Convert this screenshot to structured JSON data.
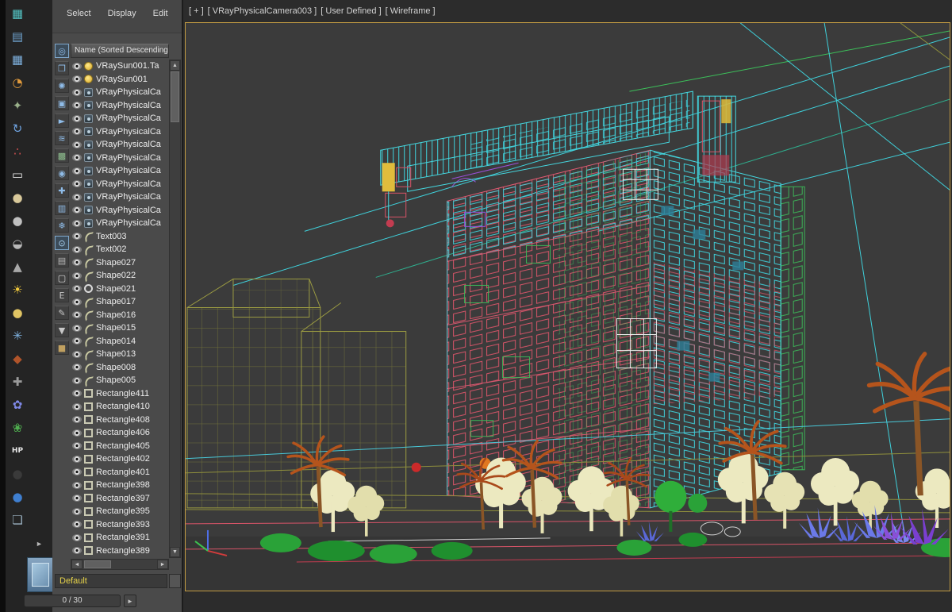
{
  "colors": {
    "viewport_border": "#c29b42",
    "viewport_bg": "#3b3b3b",
    "wire_cyan": "#45d8e0",
    "wire_red": "#e05a72",
    "wire_green": "#3cc05a",
    "wire_olive": "#8f8f3c",
    "name_field_text_color": "#e8d44a"
  },
  "glyphs": {
    "up": "▲",
    "down": "▼",
    "left": "◄",
    "right": "►"
  },
  "left_toolbar": {
    "buttons": [
      {
        "name": "schematic-view-icon",
        "glyph": "▦",
        "color": "#53c3c3"
      },
      {
        "name": "grid-page-icon",
        "glyph": "▤",
        "color": "#6fa3cf"
      },
      {
        "name": "table-grid-icon",
        "glyph": "▦",
        "color": "#7fb2e0"
      },
      {
        "name": "clock-icon",
        "glyph": "◔",
        "color": "#e09a3c"
      },
      {
        "name": "gear-icon",
        "glyph": "✦",
        "color": "#9ab08a"
      },
      {
        "name": "rotate-icon",
        "glyph": "↻",
        "color": "#6fa3e0"
      },
      {
        "name": "particles-icon",
        "glyph": "∴",
        "color": "#d05050"
      },
      {
        "name": "plane-icon",
        "glyph": "▭",
        "color": "#e8e8e8"
      },
      {
        "name": "blob-icon",
        "glyph": "●",
        "color": "#d8c89a"
      },
      {
        "name": "sphere-icon",
        "glyph": "●",
        "color": "#c0c0c0"
      },
      {
        "name": "pot-icon",
        "glyph": "◒",
        "color": "#b8b8b8"
      },
      {
        "name": "cone-icon",
        "glyph": "▲",
        "color": "#a8a8a8"
      },
      {
        "name": "sun-icon",
        "glyph": "☀",
        "color": "#f0c83c"
      },
      {
        "name": "geosphere-icon",
        "glyph": "●",
        "color": "#e0c464"
      },
      {
        "name": "scatter-icon",
        "glyph": "✳",
        "color": "#7fb2e0"
      },
      {
        "name": "pin-icon",
        "glyph": "◆",
        "color": "#b0542a"
      },
      {
        "name": "spray-icon",
        "glyph": "✚",
        "color": "#9a9a9a"
      },
      {
        "name": "flower-icon",
        "glyph": "✿",
        "color": "#7f89e8"
      },
      {
        "name": "leaf-icon",
        "glyph": "❀",
        "color": "#4fae4f"
      },
      {
        "name": "hp-icon",
        "glyph": "HP",
        "color": "#e8e8e8",
        "small": true
      },
      {
        "name": "dark-sphere-icon",
        "glyph": "●",
        "color": "#3a3a3a"
      },
      {
        "name": "blue-sphere-icon",
        "glyph": "●",
        "color": "#3f7fd0"
      },
      {
        "name": "layers-icon",
        "glyph": "❏",
        "color": "#9ab0c0"
      }
    ]
  },
  "scene_explorer": {
    "menu": [
      {
        "label": "Select"
      },
      {
        "label": "Display"
      },
      {
        "label": "Edit"
      }
    ],
    "sort_header": "Name (Sorted Descending)",
    "filter_buttons": [
      {
        "name": "select-all-filter-icon",
        "glyph": "◎",
        "color": "#8fbce8",
        "active": true
      },
      {
        "name": "children-filter-icon",
        "glyph": "❐",
        "color": "#8fbce8"
      },
      {
        "name": "lights-filter-icon",
        "glyph": "✺",
        "color": "#8fbce8"
      },
      {
        "name": "cameras-filter-icon",
        "glyph": "▣",
        "color": "#8fbce8"
      },
      {
        "name": "pointer-filter-icon",
        "glyph": "►",
        "color": "#8fbce8"
      },
      {
        "name": "space-warps-filter-icon",
        "glyph": "≋",
        "color": "#8fbce8"
      },
      {
        "name": "geometry-filter-icon",
        "glyph": "▩",
        "color": "#8fc08f"
      },
      {
        "name": "helpers-filter-icon",
        "glyph": "◉",
        "color": "#8fbce8"
      },
      {
        "name": "bones-filter-icon",
        "glyph": "✚",
        "color": "#8fbce8"
      },
      {
        "name": "containers-filter-icon",
        "glyph": "▥",
        "color": "#8fbce8"
      },
      {
        "name": "frozen-filter-icon",
        "glyph": "❄",
        "color": "#8fbce8"
      },
      {
        "name": "visibility-filter-icon",
        "glyph": "⊙",
        "color": "#aad4f4",
        "active": true
      },
      {
        "name": "document-icon",
        "glyph": "▤",
        "color": "#b8b8b8"
      },
      {
        "name": "box-filter-icon",
        "glyph": "▢",
        "color": "#d8d8d8"
      },
      {
        "name": "e-badge-icon",
        "glyph": "E",
        "color": "#c8c8c8"
      },
      {
        "name": "pen-icon",
        "glyph": "✎",
        "color": "#c8c8c8"
      },
      {
        "name": "funnel-filter-icon",
        "glyph": "▼",
        "color": "#c8c8c8"
      },
      {
        "name": "folder-icon",
        "glyph": "■",
        "color": "#c0a060"
      }
    ],
    "rows": [
      {
        "label": "VRaySun001.Ta",
        "type": "light"
      },
      {
        "label": "VRaySun001",
        "type": "light"
      },
      {
        "label": "VRayPhysicalCa",
        "type": "camera"
      },
      {
        "label": "VRayPhysicalCa",
        "type": "camera"
      },
      {
        "label": "VRayPhysicalCa",
        "type": "camera"
      },
      {
        "label": "VRayPhysicalCa",
        "type": "camera"
      },
      {
        "label": "VRayPhysicalCa",
        "type": "camera"
      },
      {
        "label": "VRayPhysicalCa",
        "type": "camera"
      },
      {
        "label": "VRayPhysicalCa",
        "type": "camera"
      },
      {
        "label": "VRayPhysicalCa",
        "type": "camera"
      },
      {
        "label": "VRayPhysicalCa",
        "type": "camera"
      },
      {
        "label": "VRayPhysicalCa",
        "type": "camera"
      },
      {
        "label": "VRayPhysicalCa",
        "type": "camera"
      },
      {
        "label": "Text003",
        "type": "spline"
      },
      {
        "label": "Text002",
        "type": "spline"
      },
      {
        "label": "Shape027",
        "type": "spline"
      },
      {
        "label": "Shape022",
        "type": "spline"
      },
      {
        "label": "Shape021",
        "type": "circle"
      },
      {
        "label": "Shape017",
        "type": "spline"
      },
      {
        "label": "Shape016",
        "type": "spline"
      },
      {
        "label": "Shape015",
        "type": "spline"
      },
      {
        "label": "Shape014",
        "type": "spline"
      },
      {
        "label": "Shape013",
        "type": "spline"
      },
      {
        "label": "Shape008",
        "type": "spline"
      },
      {
        "label": "Shape005",
        "type": "spline"
      },
      {
        "label": "Rectangle411",
        "type": "rect"
      },
      {
        "label": "Rectangle410",
        "type": "rect"
      },
      {
        "label": "Rectangle408",
        "type": "rect"
      },
      {
        "label": "Rectangle406",
        "type": "rect"
      },
      {
        "label": "Rectangle405",
        "type": "rect"
      },
      {
        "label": "Rectangle402",
        "type": "rect"
      },
      {
        "label": "Rectangle401",
        "type": "rect"
      },
      {
        "label": "Rectangle398",
        "type": "rect"
      },
      {
        "label": "Rectangle397",
        "type": "rect"
      },
      {
        "label": "Rectangle395",
        "type": "rect"
      },
      {
        "label": "Rectangle393",
        "type": "rect"
      },
      {
        "label": "Rectangle391",
        "type": "rect"
      },
      {
        "label": "Rectangle389",
        "type": "rect"
      }
    ],
    "name_field": "Default",
    "pager_value": "0 / 30"
  },
  "viewport": {
    "header_segments": [
      "[ + ]",
      "[ VRayPhysicalCamera003 ]",
      "[ User Defined ]",
      "[ Wireframe ]"
    ]
  }
}
